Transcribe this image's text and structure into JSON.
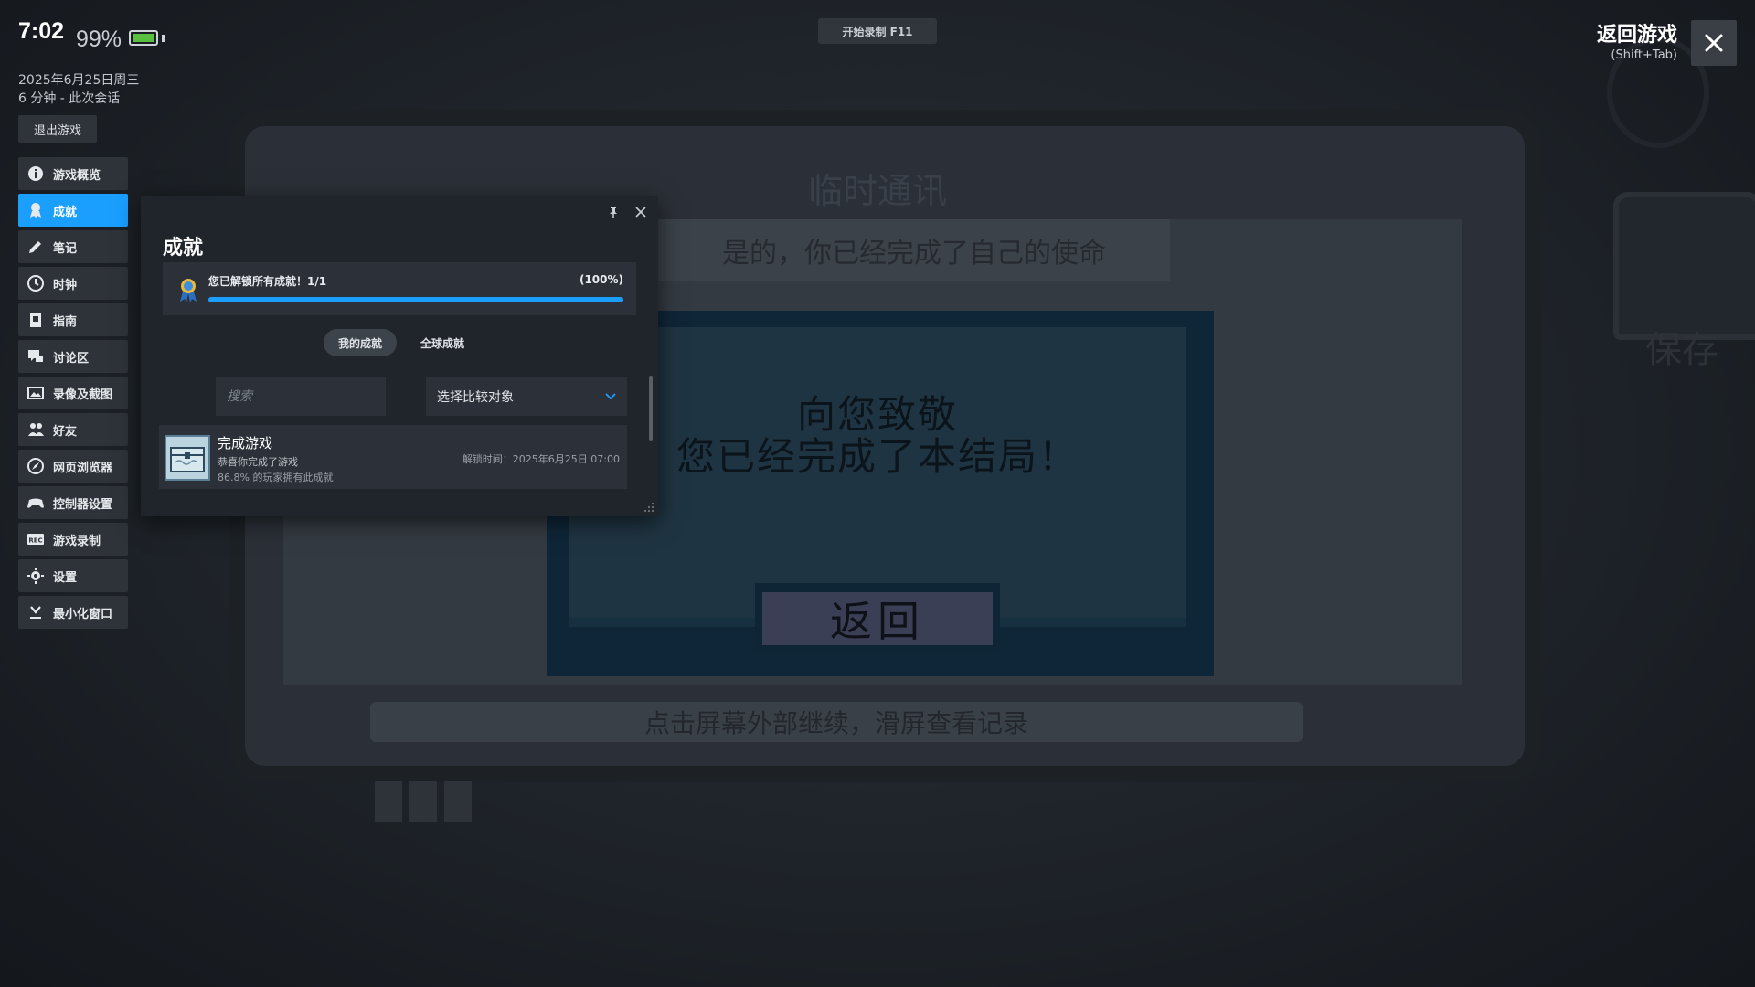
{
  "status": {
    "time": "7:02",
    "battery_pct": "99%",
    "battery_level": 0.99,
    "battery_color": "#59bf40",
    "date": "2025年6月25日周三",
    "session": "6 分钟 - 此次会话",
    "exit_label": "退出游戏"
  },
  "sidebar": {
    "items": [
      {
        "label": "游戏概览",
        "icon": "info-icon"
      },
      {
        "label": "成就",
        "icon": "achievement-icon",
        "active": true
      },
      {
        "label": "笔记",
        "icon": "pencil-icon"
      },
      {
        "label": "时钟",
        "icon": "clock-icon"
      },
      {
        "label": "指南",
        "icon": "guide-icon"
      },
      {
        "label": "讨论区",
        "icon": "chat-icon"
      },
      {
        "label": "录像及截图",
        "icon": "screenshot-icon"
      },
      {
        "label": "好友",
        "icon": "friends-icon"
      },
      {
        "label": "网页浏览器",
        "icon": "browser-icon"
      },
      {
        "label": "控制器设置",
        "icon": "controller-icon"
      },
      {
        "label": "游戏录制",
        "icon": "rec-icon"
      },
      {
        "label": "设置",
        "icon": "gear-icon"
      },
      {
        "label": "最小化窗口",
        "icon": "minimize-icon"
      }
    ]
  },
  "recording": {
    "label": "开始录制 F11"
  },
  "return_game": {
    "title": "返回游戏",
    "hint": "(Shift+Tab)"
  },
  "achievements_panel": {
    "title": "成就",
    "progress": {
      "label": "您已解锁所有成就！1/1",
      "percent_text": "(100%)",
      "value": 1.0
    },
    "tabs": [
      {
        "label": "我的成就",
        "active": true
      },
      {
        "label": "全球成就",
        "active": false
      }
    ],
    "search_placeholder": "搜索",
    "compare_label": "选择比较对象",
    "items": [
      {
        "name": "完成游戏",
        "description": "恭喜你完成了游戏",
        "global_rate": "86.8% 的玩家拥有此成就",
        "unlock_time": "解锁时间：2025年6月25日 07:00"
      }
    ]
  },
  "game": {
    "title": "临时通讯",
    "banner": "是的，你已经完成了自己的使命",
    "message_line1": "向您致敬",
    "message_line2": "您已经完成了本结局！",
    "back_button": "返回",
    "bottom_hint": "点击屏幕外部继续，滑屏查看记录",
    "save_label": "保存"
  },
  "colors": {
    "accent": "#1a9fff",
    "panel_bg": "#20252c"
  }
}
